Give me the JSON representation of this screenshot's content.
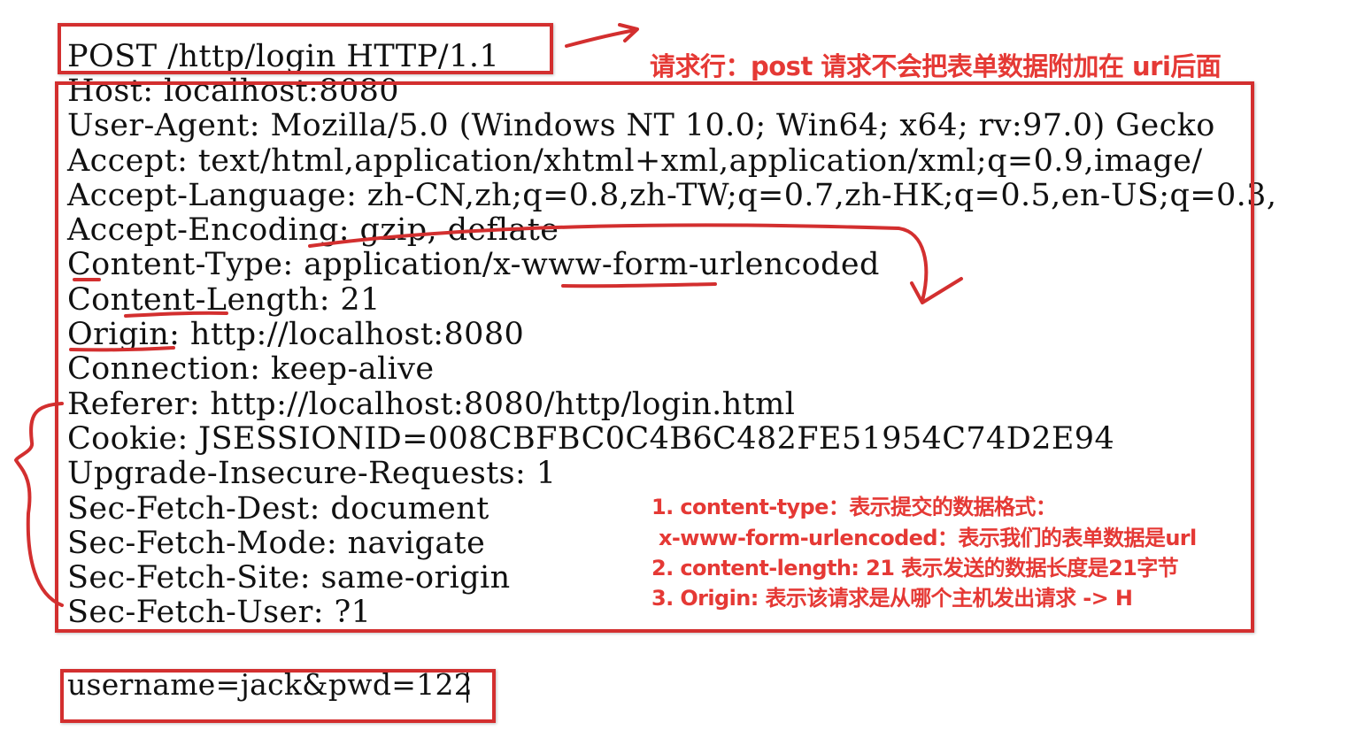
{
  "request": {
    "request_line": "POST /http/login HTTP/1.1",
    "headers": [
      "Host: localhost:8080",
      "User-Agent: Mozilla/5.0 (Windows NT 10.0; Win64; x64; rv:97.0) Gecko",
      "Accept: text/html,application/xhtml+xml,application/xml;q=0.9,image/",
      "Accept-Language: zh-CN,zh;q=0.8,zh-TW;q=0.7,zh-HK;q=0.5,en-US;q=0.3,",
      "Accept-Encoding: gzip, deflate",
      "Content-Type: application/x-www-form-urlencoded",
      "Content-Length: 21",
      "Origin: http://localhost:8080",
      "Connection: keep-alive",
      "Referer: http://localhost:8080/http/login.html",
      "Cookie: JSESSIONID=008CBFBC0C4B6C482FE51954C74D2E94",
      "Upgrade-Insecure-Requests: 1",
      "Sec-Fetch-Dest: document",
      "Sec-Fetch-Mode: navigate",
      "Sec-Fetch-Site: same-origin",
      "Sec-Fetch-User: ?1"
    ],
    "body": "username=jack&pwd=122"
  },
  "annotations": {
    "request_line_note": "请求行：post 请求不会把表单数据附加在 uri后面",
    "notes": [
      "1. content-type：表示提交的数据格式：",
      "x-www-form-urlencoded：表示我们的表单数据是url",
      "2. content-length: 21 表示发送的数据长度是21字节",
      "3. Origin: 表示该请求是从哪个主机发出请求 -> H"
    ]
  },
  "colors": {
    "annotation_red": "#d32f2f",
    "text": "#111111",
    "background": "#ffffff"
  }
}
